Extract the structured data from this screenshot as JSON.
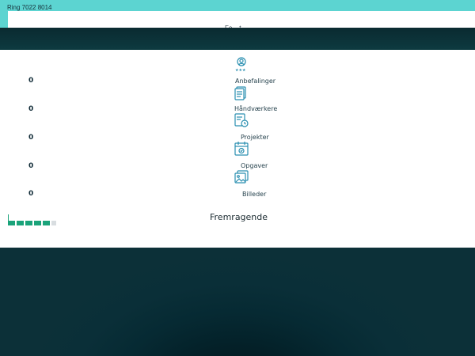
{
  "header": {
    "phone_text": "Ring 7022 8014",
    "menu_label": "Fo... t"
  },
  "stats": [
    {
      "value": "0",
      "label": "Anbefalinger",
      "icon": "user-rating-icon"
    },
    {
      "value": "0",
      "label": "Håndværkere",
      "icon": "documents-icon"
    },
    {
      "value": "0",
      "label": "Projekter",
      "icon": "project-clock-icon"
    },
    {
      "value": "0",
      "label": "Opgaver",
      "icon": "calendar-check-icon"
    },
    {
      "value": "0",
      "label": "Billeder",
      "icon": "images-icon"
    }
  ],
  "rating": {
    "label": "Fremragende",
    "filled_stars": 5,
    "total_stars": 6
  },
  "colors": {
    "top_bar": "#5cd4d1",
    "dark_band": "#0d3a40",
    "icon": "#2a8fb0",
    "star": "#1aa37a"
  }
}
